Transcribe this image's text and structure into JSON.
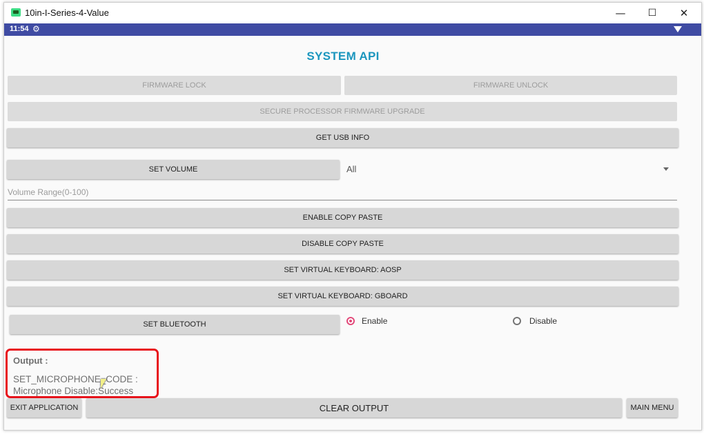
{
  "window": {
    "title": "10in-I-Series-4-Value",
    "minimize": "—",
    "maximize": "☐",
    "close": "✕"
  },
  "statusbar": {
    "time": "11:54",
    "icons": [
      "gear-icon",
      "wifi-icon"
    ]
  },
  "app": {
    "heading": "SYSTEM API",
    "buttons": {
      "firmware_lock": "FIRMWARE LOCK",
      "firmware_unlock": "FIRMWARE UNLOCK",
      "secure_processor": "SECURE PROCESSOR FIRMWARE UPGRADE",
      "get_usb_info": "GET USB INFO",
      "set_volume": "SET VOLUME",
      "enable_copy_paste": "ENABLE COPY PASTE",
      "disable_copy_paste": "DISABLE COPY PASTE",
      "set_keyboard_aosp": "SET VIRTUAL KEYBOARD: AOSP",
      "set_keyboard_gboard": "SET VIRTUAL KEYBOARD: GBOARD",
      "set_bluetooth": "SET BLUETOOTH",
      "exit_application": "EXIT APPLICATION",
      "clear_output": "CLEAR OUTPUT",
      "main_menu": "MAIN MENU"
    },
    "volume_stream": {
      "selected": "All"
    },
    "volume_input": {
      "value": "",
      "placeholder": "Volume Range(0-100)"
    },
    "bluetooth": {
      "enable_label": "Enable",
      "disable_label": "Disable",
      "selected": "Enable"
    },
    "output": {
      "label": "Output :",
      "text": "SET_MICROPHONE_CODE :\nMicrophone Disable:Success"
    },
    "colors": {
      "heading": "#1b96be",
      "statusbar": "#3f4ba3",
      "radio_accent": "#e24a7a",
      "highlight": "#e8131b"
    }
  }
}
